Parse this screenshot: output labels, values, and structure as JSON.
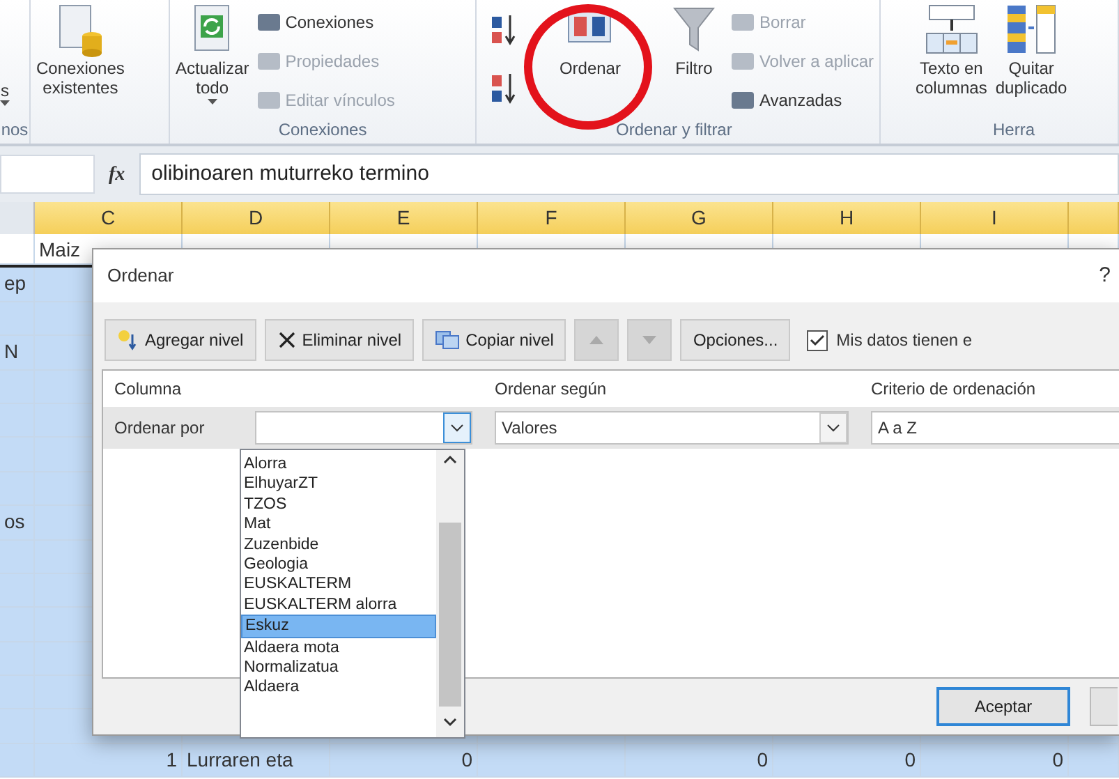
{
  "ribbon": {
    "groups": [
      {
        "label": "nos",
        "items": [
          {
            "kind": "large",
            "label": "s",
            "menu": true
          }
        ]
      },
      {
        "items": [
          {
            "kind": "large",
            "label": "Conexiones\nexistentes",
            "menu": false
          }
        ]
      },
      {
        "label": "Conexiones",
        "items": [
          {
            "kind": "large",
            "label": "Actualizar\ntodo",
            "menu": true
          },
          {
            "kind": "stack",
            "buttons": [
              {
                "label": "Conexiones",
                "disabled": false
              },
              {
                "label": "Propiedades",
                "disabled": true
              },
              {
                "label": "Editar vínculos",
                "disabled": true
              }
            ]
          }
        ]
      },
      {
        "label": "Ordenar y filtrar",
        "items": [
          {
            "kind": "sort"
          },
          {
            "kind": "large",
            "label": "Ordenar",
            "menu": false
          },
          {
            "kind": "large",
            "label": "Filtro",
            "menu": false
          },
          {
            "kind": "stack",
            "buttons": [
              {
                "label": "Borrar",
                "disabled": true
              },
              {
                "label": "Volver a aplicar",
                "disabled": true
              },
              {
                "label": "Avanzadas",
                "disabled": false
              }
            ]
          }
        ]
      },
      {
        "label": "Herra",
        "items": [
          {
            "kind": "large",
            "label": "Texto en\ncolumnas",
            "menu": false
          },
          {
            "kind": "large",
            "label": "Quitar\nduplicado",
            "menu": false
          }
        ]
      }
    ]
  },
  "formula_bar": {
    "function_label": "fx",
    "value": "olibinoaren muturreko termino"
  },
  "sheet": {
    "columns": [
      "C",
      "D",
      "E",
      "F",
      "G",
      "H",
      "I"
    ],
    "rows": [
      {
        "selected": false,
        "cells": [
          null,
          "Maiz",
          null,
          null,
          null,
          null,
          null,
          null
        ]
      },
      {
        "selected": true,
        "cells": [
          "ep",
          null,
          null,
          null,
          null,
          null,
          null,
          null
        ]
      },
      {
        "selected": true
      },
      {
        "selected": true,
        "cells": [
          "N",
          null,
          null,
          null,
          null,
          null,
          null,
          null
        ]
      },
      {
        "selected": true
      },
      {
        "selected": true
      },
      {
        "selected": true
      },
      {
        "selected": true
      },
      {
        "selected": true,
        "cells": [
          "os",
          null,
          null,
          null,
          null,
          null,
          null,
          null
        ]
      },
      {
        "selected": true
      },
      {
        "selected": true
      },
      {
        "selected": true
      },
      {
        "selected": true
      },
      {
        "selected": true
      },
      {
        "selected": true
      },
      {
        "selected": true,
        "cells": [
          null,
          "1",
          "Lurraren eta",
          "0",
          null,
          "0",
          "0",
          "0"
        ]
      }
    ]
  },
  "dialog": {
    "title": "Ordenar",
    "help": "?",
    "toolbar": [
      {
        "kind": "button",
        "label": "Agregar nivel",
        "disabled": false
      },
      {
        "kind": "button",
        "label": "Eliminar nivel",
        "disabled": false
      },
      {
        "kind": "button",
        "label": "Copiar nivel",
        "disabled": false
      },
      {
        "kind": "up",
        "disabled": true
      },
      {
        "kind": "down",
        "disabled": true
      },
      {
        "kind": "button",
        "label": "Opciones...",
        "disabled": false
      }
    ],
    "header_checkbox": {
      "label": "Mis datos tienen e",
      "checked": true
    },
    "columns": [
      "Columna",
      "Ordenar según",
      "Criterio de ordenación"
    ],
    "level": {
      "label": "Ordenar por",
      "column": {
        "expanded": true
      },
      "sort_on": "Valores",
      "order": "A a Z"
    },
    "dropdown": [
      {
        "label": "Alorra",
        "selected": false
      },
      {
        "label": "ElhuyarZT",
        "selected": false
      },
      {
        "label": "TZOS",
        "selected": false
      },
      {
        "label": "Mat",
        "selected": false
      },
      {
        "label": "Zuzenbide",
        "selected": false
      },
      {
        "label": "Geologia",
        "selected": false
      },
      {
        "label": "EUSKALTERM",
        "selected": false
      },
      {
        "label": "EUSKALTERM alorra",
        "selected": false
      },
      {
        "label": "Eskuz",
        "selected": true
      },
      {
        "label": "Aldaera mota",
        "selected": false
      },
      {
        "label": "Normalizatua",
        "selected": false
      },
      {
        "label": "Aldaera",
        "selected": false
      }
    ],
    "buttons": [
      "Aceptar"
    ]
  }
}
